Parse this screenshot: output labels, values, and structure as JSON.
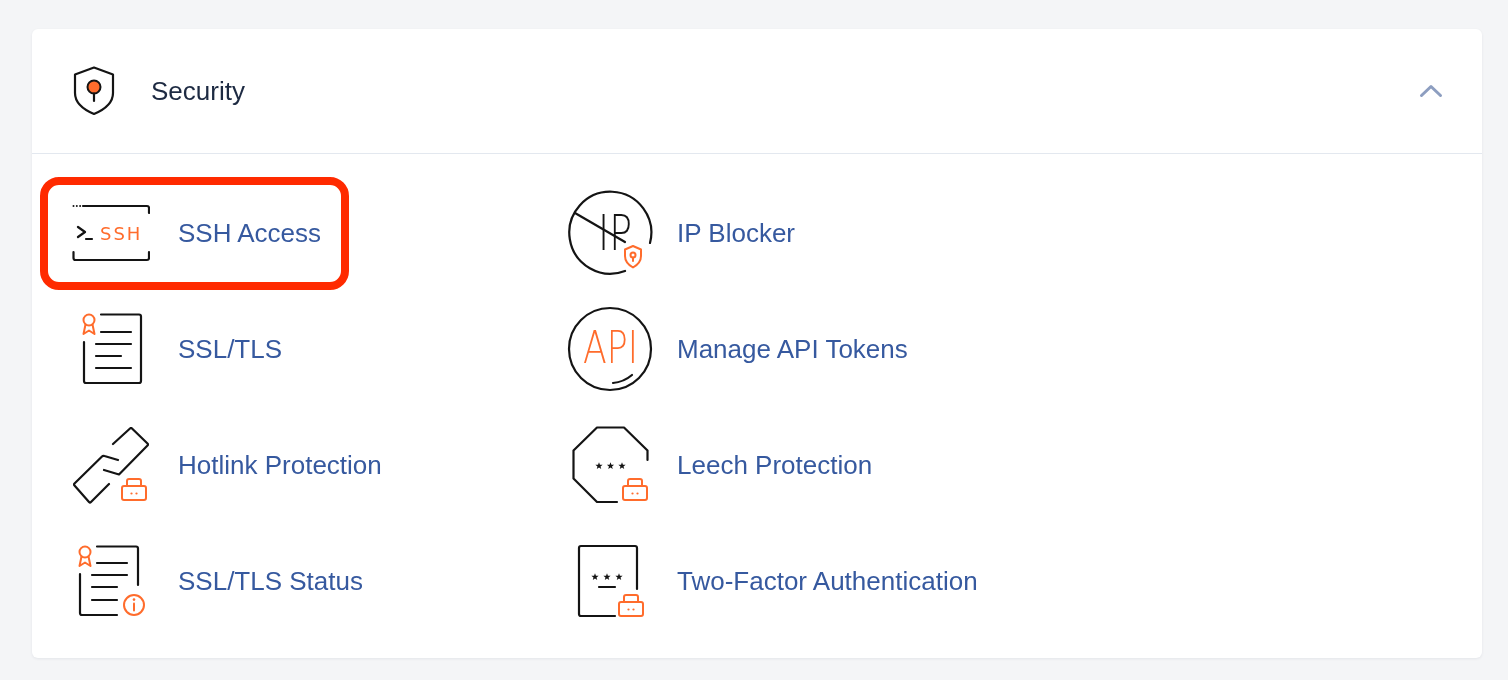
{
  "section": {
    "title": "Security",
    "expanded": true
  },
  "tools": [
    {
      "kind": "ssh",
      "label": "SSH Access",
      "icon_text": "SSH",
      "highlighted": true
    },
    {
      "kind": "ip-blocker",
      "label": "IP Blocker",
      "icon_text": "IP",
      "highlighted": false
    },
    {
      "kind": "certificate",
      "label": "SSL/TLS",
      "highlighted": false
    },
    {
      "kind": "api",
      "label": "Manage API Tokens",
      "icon_text": "API",
      "highlighted": false
    },
    {
      "kind": "chain-lock",
      "label": "Hotlink Protection",
      "highlighted": false
    },
    {
      "kind": "octagon-lock",
      "label": "Leech Protection",
      "highlighted": false
    },
    {
      "kind": "certificate-info",
      "label": "SSL/TLS Status",
      "highlighted": false
    },
    {
      "kind": "document-lock",
      "label": "Two-Factor Authentication",
      "highlighted": false
    }
  ]
}
